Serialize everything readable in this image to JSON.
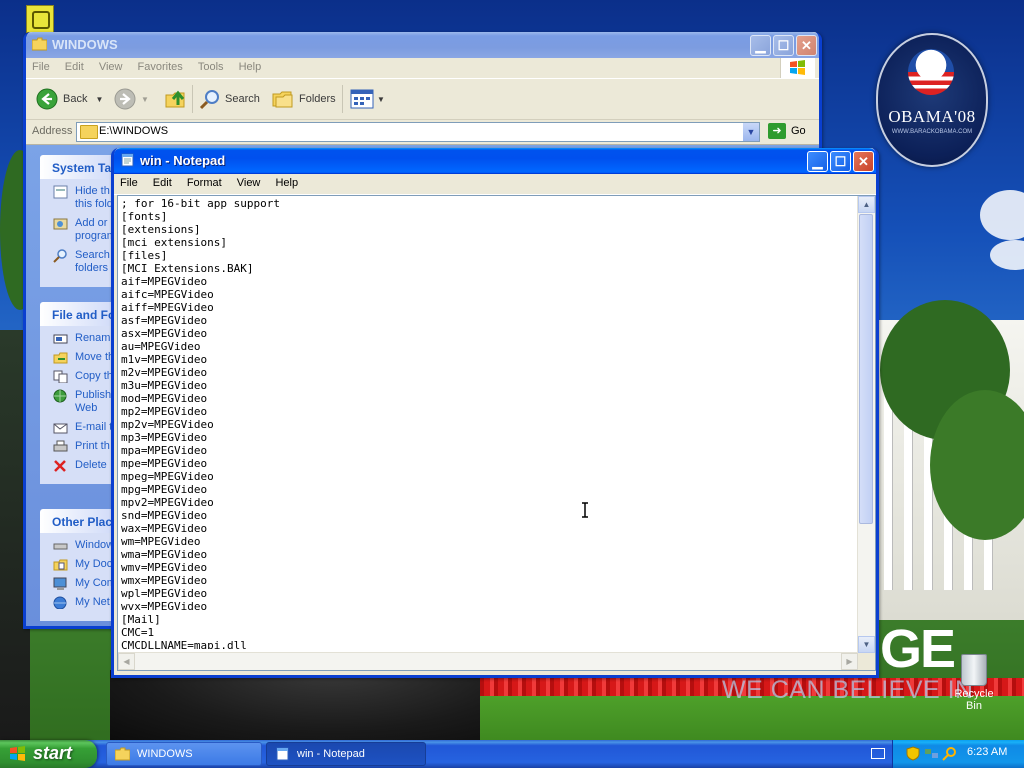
{
  "desktop": {
    "logo_main": "OBAMA'08",
    "logo_sub": "WWW.BARACKOBAMA.COM",
    "slogan_big": "GE",
    "slogan_small": "WE CAN BELIEVE IN",
    "recycle_bin_label": "Recycle Bin"
  },
  "explorer": {
    "title": "WINDOWS",
    "menu": [
      "File",
      "Edit",
      "View",
      "Favorites",
      "Tools",
      "Help"
    ],
    "toolbar": {
      "back": "Back",
      "search": "Search",
      "folders": "Folders"
    },
    "address_label": "Address",
    "address_value": "E:\\WINDOWS",
    "go_label": "Go",
    "panels": {
      "system_tasks": {
        "title": "System Ta",
        "items": [
          "Hide th\nthis fold",
          "Add or\nprogram",
          "Search\nfolders"
        ]
      },
      "file_folder": {
        "title": "File and Fo",
        "items": [
          "Rename",
          "Move th",
          "Copy th",
          "Publish\nWeb",
          "E-mail t",
          "Print th",
          "Delete"
        ]
      },
      "other_places": {
        "title": "Other Plac",
        "items": [
          "Window",
          "My Doc",
          "My Com",
          "My Net"
        ]
      }
    }
  },
  "notepad": {
    "title": "win - Notepad",
    "menu": [
      "File",
      "Edit",
      "Format",
      "View",
      "Help"
    ],
    "lines": [
      "; for 16-bit app support",
      "[fonts]",
      "[extensions]",
      "[mci extensions]",
      "[files]",
      "[MCI Extensions.BAK]",
      "aif=MPEGVideo",
      "aifc=MPEGVideo",
      "aiff=MPEGVideo",
      "asf=MPEGVideo",
      "asx=MPEGVideo",
      "au=MPEGVideo",
      "m1v=MPEGVideo",
      "m2v=MPEGVideo",
      "m3u=MPEGVideo",
      "mod=MPEGVideo",
      "mp2=MPEGVideo",
      "mp2v=MPEGVideo",
      "mp3=MPEGVideo",
      "mpa=MPEGVideo",
      "mpe=MPEGVideo",
      "mpeg=MPEGVideo",
      "mpg=MPEGVideo",
      "mpv2=MPEGVideo",
      "snd=MPEGVideo",
      "wax=MPEGVideo",
      "wm=MPEGVideo",
      "wma=MPEGVideo",
      "wmv=MPEGVideo",
      "wmx=MPEGVideo",
      "wpl=MPEGVideo",
      "wvx=MPEGVideo",
      "[Mail]",
      "CMC=1",
      "CMCDLLNAME=mapi.dll"
    ]
  },
  "taskbar": {
    "start_label": "start",
    "tasks": [
      {
        "label": "WINDOWS",
        "active": false
      },
      {
        "label": "win - Notepad",
        "active": true
      }
    ],
    "clock": "6:23 AM"
  },
  "colors": {
    "xp_blue": "#0053ee",
    "start_green": "#36a036",
    "tray_blue": "#0f8ae6",
    "link_blue": "#215dc6"
  }
}
